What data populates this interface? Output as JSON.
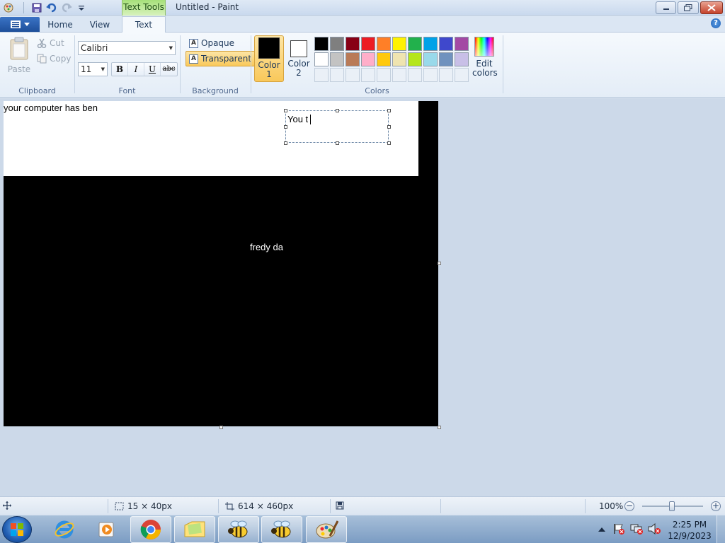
{
  "window": {
    "title": "Untitled - Paint",
    "context_tab": "Text Tools"
  },
  "ribbon_tabs": [
    {
      "label": "Home"
    },
    {
      "label": "View"
    },
    {
      "label": "Text",
      "active": true
    }
  ],
  "clipboard": {
    "paste": "Paste",
    "cut": "Cut",
    "copy": "Copy",
    "group": "Clipboard"
  },
  "font": {
    "family": "Calibri",
    "size": "11",
    "bold": "B",
    "italic": "I",
    "underline": "U",
    "strikethrough": "abc",
    "group": "Font"
  },
  "background": {
    "opaque": "Opaque",
    "transparent": "Transparent",
    "selected": "transparent",
    "group": "Background"
  },
  "colors": {
    "color1_label_a": "Color",
    "color1_label_b": "1",
    "color1_value": "#000000",
    "color2_label_a": "Color",
    "color2_label_b": "2",
    "color2_value": "#ffffff",
    "edit_label_a": "Edit",
    "edit_label_b": "colors",
    "group": "Colors",
    "palette_row1": [
      "#000000",
      "#7f7f7f",
      "#880015",
      "#ed1c24",
      "#ff7f27",
      "#fff200",
      "#22b14c",
      "#00a2e8",
      "#3f48cc",
      "#a349a4"
    ],
    "palette_row2": [
      "#ffffff",
      "#c3c3c3",
      "#b97a57",
      "#ffaec9",
      "#ffc90e",
      "#efe4b0",
      "#b5e61d",
      "#99d9ea",
      "#7092be",
      "#c8bfe7"
    ]
  },
  "canvas": {
    "text_top_left": "your computer has ben",
    "text_box": "You t",
    "text_center": "fredy da",
    "accent_text_color": "#ffffff"
  },
  "statusbar": {
    "selection_size": "15 × 40px",
    "image_size": "614 × 460px",
    "zoom": "100%",
    "zoom_level": 1.0
  },
  "taskbar": {
    "time": "2:25 PM",
    "date": "12/9/2023",
    "apps": [
      "internet-explorer",
      "windows-media-player",
      "google-chrome",
      "file-explorer",
      "bee-app",
      "bee-app",
      "paint"
    ]
  }
}
